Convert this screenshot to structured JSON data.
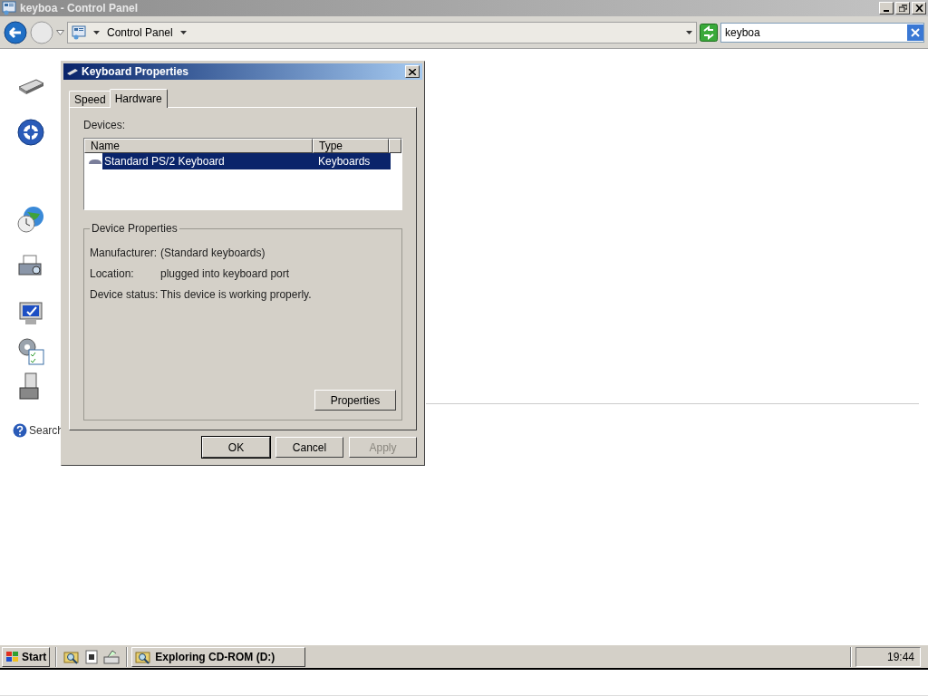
{
  "window": {
    "title": "keyboa - Control Panel"
  },
  "address_bar": {
    "path": "Control Panel"
  },
  "search": {
    "value": "keyboa"
  },
  "results": [
    {
      "kind": "keyboard"
    },
    {
      "kind": "accessibility"
    },
    {
      "kind": "globe"
    },
    {
      "kind": "printer"
    },
    {
      "kind": "monitor"
    },
    {
      "kind": "gear"
    },
    {
      "kind": "tower"
    }
  ],
  "search_help": {
    "label": "Search"
  },
  "dialog": {
    "title": "Keyboard Properties",
    "tabs": [
      {
        "label": "Speed",
        "selected": false
      },
      {
        "label": "Hardware",
        "selected": true
      }
    ],
    "devices_label": "Devices:",
    "columns": [
      "Name",
      "Type"
    ],
    "devices": [
      {
        "name": "Standard PS/2 Keyboard",
        "type": "Keyboards",
        "selected": true
      }
    ],
    "group_title": "Device Properties",
    "properties": [
      {
        "label": "Manufacturer:",
        "value": "(Standard keyboards)"
      },
      {
        "label": "Location:",
        "value": "plugged into keyboard port"
      },
      {
        "label": "Device status:",
        "value": "This device is working properly."
      }
    ],
    "properties_button": "Properties",
    "buttons": [
      {
        "label": "OK",
        "disabled": false
      },
      {
        "label": "Cancel",
        "disabled": false
      },
      {
        "label": "Apply",
        "disabled": true
      }
    ]
  },
  "taskbar": {
    "start": "Start",
    "tasks": [
      {
        "label": "Exploring CD-ROM (D:)",
        "selected": false
      }
    ],
    "clock": "19:44"
  }
}
